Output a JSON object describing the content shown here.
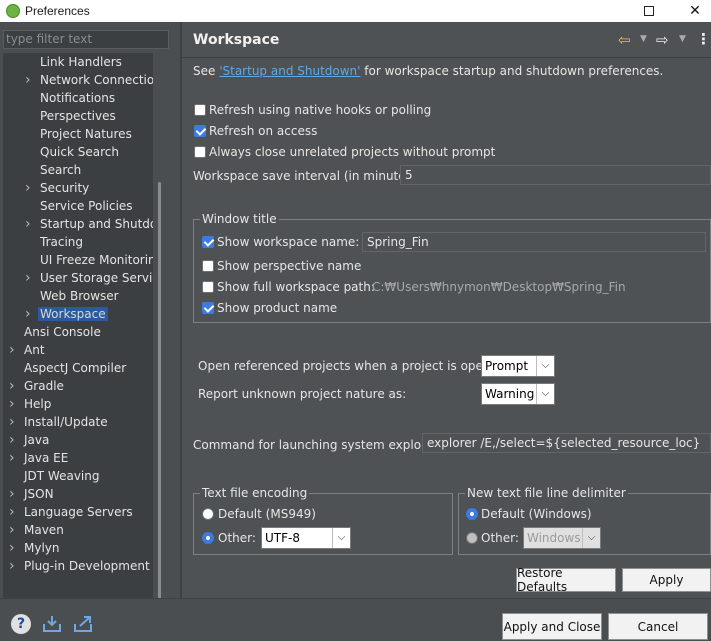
{
  "window": {
    "title": "Preferences"
  },
  "filter": {
    "placeholder": "type filter text"
  },
  "tree": {
    "items": [
      {
        "label": "Link Handlers",
        "expandable": false
      },
      {
        "label": "Network Connections",
        "expandable": true
      },
      {
        "label": "Notifications",
        "expandable": false
      },
      {
        "label": "Perspectives",
        "expandable": false
      },
      {
        "label": "Project Natures",
        "expandable": false
      },
      {
        "label": "Quick Search",
        "expandable": false
      },
      {
        "label": "Search",
        "expandable": false
      },
      {
        "label": "Security",
        "expandable": true
      },
      {
        "label": "Service Policies",
        "expandable": false
      },
      {
        "label": "Startup and Shutdown",
        "expandable": true
      },
      {
        "label": "Tracing",
        "expandable": false
      },
      {
        "label": "UI Freeze Monitoring",
        "expandable": false
      },
      {
        "label": "User Storage Service",
        "expandable": true
      },
      {
        "label": "Web Browser",
        "expandable": false
      },
      {
        "label": "Workspace",
        "expandable": true,
        "selected": true
      },
      {
        "label": "Ansi Console",
        "expandable": false
      },
      {
        "label": "Ant",
        "expandable": true
      },
      {
        "label": "AspectJ Compiler",
        "expandable": false
      },
      {
        "label": "Gradle",
        "expandable": true
      },
      {
        "label": "Help",
        "expandable": true
      },
      {
        "label": "Install/Update",
        "expandable": true
      },
      {
        "label": "Java",
        "expandable": true
      },
      {
        "label": "Java EE",
        "expandable": true
      },
      {
        "label": "JDT Weaving",
        "expandable": false
      },
      {
        "label": "JSON",
        "expandable": true
      },
      {
        "label": "Language Servers",
        "expandable": true
      },
      {
        "label": "Maven",
        "expandable": true
      },
      {
        "label": "Mylyn",
        "expandable": true
      },
      {
        "label": "Plug-in Development",
        "expandable": true
      }
    ]
  },
  "page": {
    "title": "Workspace",
    "intro_prefix": "See ",
    "intro_link": "'Startup and Shutdown'",
    "intro_suffix": " for workspace startup and shutdown preferences.",
    "refresh_native": {
      "label": "Refresh using native hooks or polling",
      "checked": false
    },
    "refresh_access": {
      "label": "Refresh on access",
      "checked": true
    },
    "always_close": {
      "label": "Always close unrelated projects without prompt",
      "checked": false
    },
    "save_interval": {
      "label": "Workspace save interval (in minutes):",
      "value": "5"
    },
    "window_title": {
      "group_label": "Window title",
      "show_ws_name": {
        "label": "Show workspace name:",
        "checked": true,
        "value": "Spring_Fin"
      },
      "show_perspective": {
        "label": "Show perspective name",
        "checked": false
      },
      "show_full_path": {
        "label": "Show full workspace path:",
        "checked": false,
        "value": "C:₩Users₩hnymon₩Desktop₩Spring_Fin"
      },
      "show_product": {
        "label": "Show product name",
        "checked": true
      }
    },
    "open_referenced": {
      "label": "Open referenced projects when a project is opened:",
      "value": "Prompt"
    },
    "report_unknown": {
      "label": "Report unknown project nature as:",
      "value": "Warning"
    },
    "command_explorer": {
      "label": "Command for launching system explorer:",
      "value": "explorer /E,/select=${selected_resource_loc}"
    },
    "encoding": {
      "group_label": "Text file encoding",
      "default_label": "Default (MS949)",
      "other_label": "Other:",
      "other_value": "UTF-8",
      "selected": "other"
    },
    "line_delimiter": {
      "group_label": "New text file line delimiter",
      "default_label": "Default (Windows)",
      "other_label": "Other:",
      "other_value": "Windows",
      "selected": "default"
    },
    "restore_defaults": "Restore Defaults",
    "apply": "Apply"
  },
  "footer": {
    "apply_close": "Apply and Close",
    "cancel": "Cancel"
  },
  "icons": {
    "help": "help-icon",
    "import": "import-icon",
    "export": "export-icon",
    "back": "arrow-left-icon",
    "forward": "arrow-right-icon",
    "menu": "more-vertical-icon"
  },
  "colors": {
    "accent": "#3d7be0",
    "link": "#5fa8e8",
    "selection": "#2b5a9e",
    "back_arrow": "#e8c33a"
  }
}
